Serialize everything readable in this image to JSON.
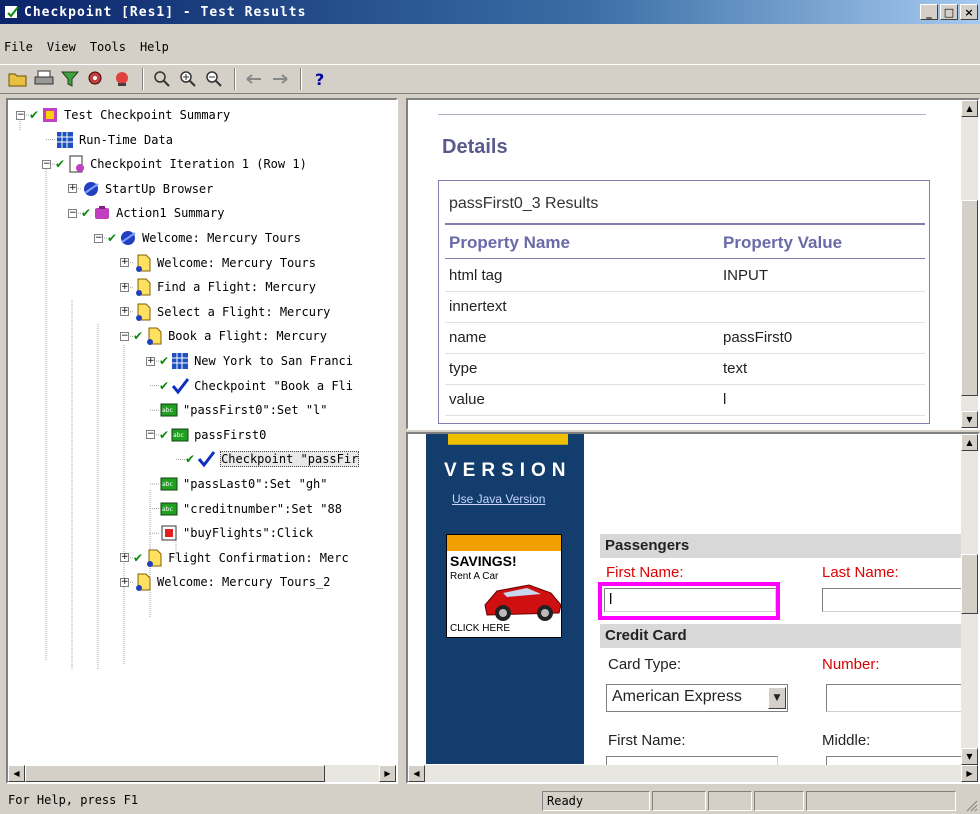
{
  "window": {
    "title": "Checkpoint [Res1] - Test Results",
    "minimize": "_",
    "maximize": "□",
    "close": "×"
  },
  "menu": [
    "File",
    "View",
    "Tools",
    "Help"
  ],
  "tree": [
    {
      "label": "Test Checkpoint Summary",
      "icon": "summary-icon"
    },
    {
      "label": "Run-Time Data",
      "icon": "table-icon"
    },
    {
      "label": "Checkpoint Iteration 1 (Row 1)",
      "icon": "iteration-icon"
    },
    {
      "label": "StartUp Browser",
      "icon": "browser-icon"
    },
    {
      "label": "Action1 Summary",
      "icon": "action-icon"
    },
    {
      "label": "Welcome: Mercury Tours",
      "icon": "browser-icon"
    },
    {
      "label": "Welcome: Mercury Tours",
      "icon": "page-icon"
    },
    {
      "label": "Find a Flight: Mercury",
      "icon": "page-icon"
    },
    {
      "label": "Select a Flight: Mercury",
      "icon": "page-icon"
    },
    {
      "label": "Book a Flight: Mercury",
      "icon": "page-icon"
    },
    {
      "label": "New York to San Franci",
      "icon": "table-icon"
    },
    {
      "label": "Checkpoint \"Book a Fli",
      "icon": "checkpoint-icon"
    },
    {
      "label": "\"passFirst0\":Set \"l\"",
      "icon": "editbox-icon"
    },
    {
      "label": "passFirst0",
      "icon": "editbox-icon"
    },
    {
      "label": "Checkpoint \"passFir",
      "icon": "checkpoint-icon"
    },
    {
      "label": "\"passLast0\":Set \"gh\"",
      "icon": "editbox-icon"
    },
    {
      "label": "\"creditnumber\":Set \"88",
      "icon": "editbox-icon"
    },
    {
      "label": "\"buyFlights\":Click",
      "icon": "image-icon"
    },
    {
      "label": "Flight Confirmation: Merc",
      "icon": "page-icon"
    },
    {
      "label": "Welcome: Mercury Tours_2",
      "icon": "page-icon"
    }
  ],
  "details": {
    "title": "Details",
    "results_title": "passFirst0_3 Results",
    "col_property_name": "Property Name",
    "col_property_value": "Property Value",
    "rows": [
      {
        "name": "html tag",
        "value": "INPUT"
      },
      {
        "name": "innertext",
        "value": ""
      },
      {
        "name": "name",
        "value": "passFirst0"
      },
      {
        "name": "type",
        "value": "text"
      },
      {
        "name": "value",
        "value": "l"
      }
    ]
  },
  "browser": {
    "version_text": "VERSION",
    "java_link": "Use Java Version",
    "ad_savings": "SAVINGS!",
    "ad_rent": "Rent A Car",
    "ad_click": "CLICK HERE",
    "passengers_header": "Passengers",
    "first_name_label": "First Name:",
    "last_name_label": "Last Name:",
    "first_name_value": "l",
    "credit_card_header": "Credit Card",
    "card_type_label": "Card Type:",
    "number_label": "Number:",
    "card_type_value": "American Express",
    "cc_first_name_label": "First Name:",
    "middle_label": "Middle:"
  },
  "status": {
    "help": "For Help, press F1",
    "state": "Ready"
  },
  "colors": {
    "title_bar": "#0a246a",
    "checkmark": "#0a8a0a",
    "highlight": "#ff00ff",
    "details_heading": "#5a5a8c"
  }
}
